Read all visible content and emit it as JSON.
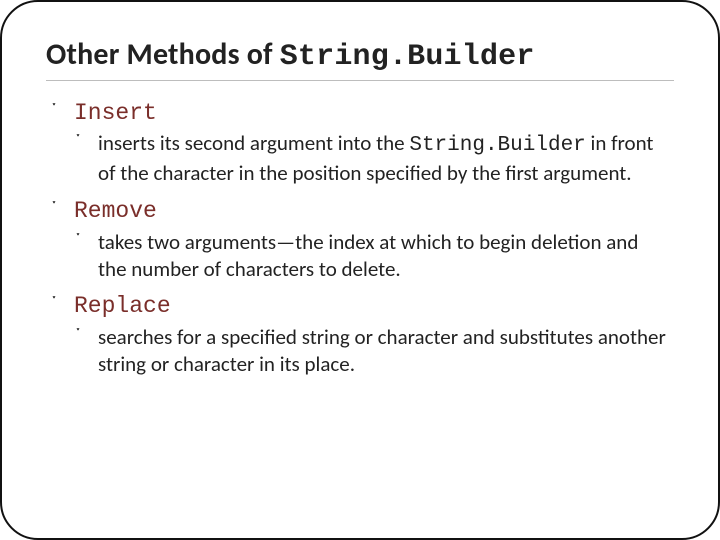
{
  "title": {
    "prefix": "Other Methods of ",
    "mono": "String.Builder"
  },
  "items": [
    {
      "name": "Insert",
      "desc_pre": "inserts its second argument into the ",
      "desc_mono": "String.Builder",
      "desc_post": " in front of the character in the position specified by the first argument."
    },
    {
      "name": "Remove",
      "desc_pre": "takes two arguments—the index at which to begin deletion and the number of characters to delete.",
      "desc_mono": "",
      "desc_post": ""
    },
    {
      "name": "Replace",
      "desc_pre": "searches for a specified string or character and substitutes another string or character in its place.",
      "desc_mono": "",
      "desc_post": ""
    }
  ],
  "bullet_glyph": "་"
}
